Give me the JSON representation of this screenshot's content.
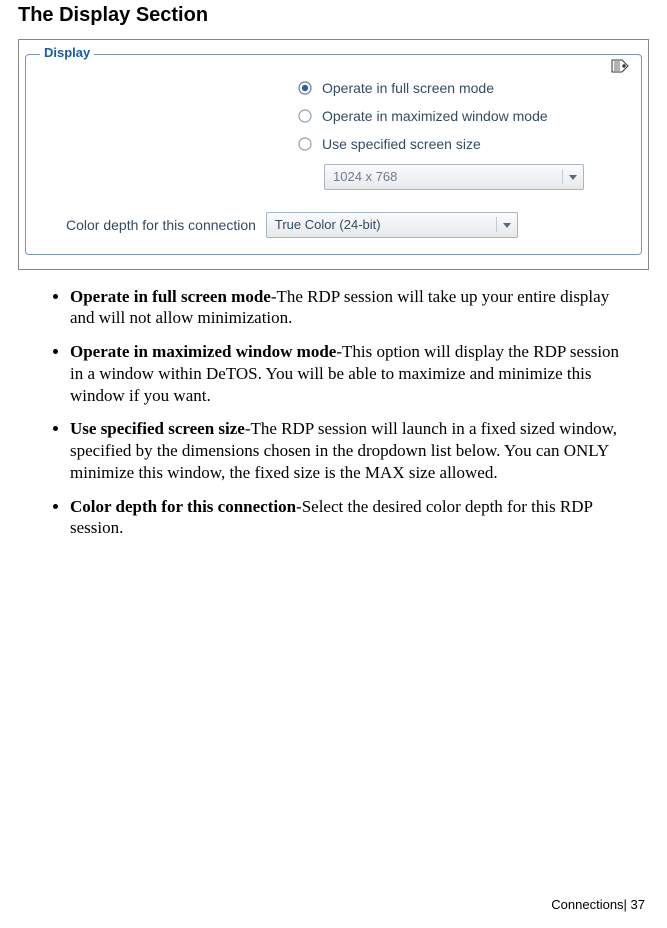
{
  "heading": "The Display Section",
  "panel": {
    "legend": "Display",
    "options": {
      "full": "Operate in full screen mode",
      "max": "Operate in maximized window mode",
      "spec": "Use specified screen size"
    },
    "selected": "full",
    "screenSize": "1024 x 768",
    "colorLabel": "Color depth for this connection",
    "colorValue": "True Color (24-bit)"
  },
  "bullets": {
    "b1": {
      "title": "Operate in full screen mode",
      "text": "-The RDP session will take up your entire display and will not allow minimization."
    },
    "b2": {
      "title": "Operate in maximized window mode",
      "text": "-This option will display the RDP session in a window within DeTOS.    You will be able to maximize and minimize this window if you want."
    },
    "b3": {
      "title": "Use specified screen size",
      "text": "-The RDP session will launch in a fixed sized window, specified by the dimensions chosen in the dropdown list below.  You can ONLY minimize this window, the fixed size is the MAX size allowed."
    },
    "b4": {
      "title": "Color depth for this connection",
      "text": "-Select the desired color depth for this RDP session."
    }
  },
  "footer": "Connections| 37"
}
